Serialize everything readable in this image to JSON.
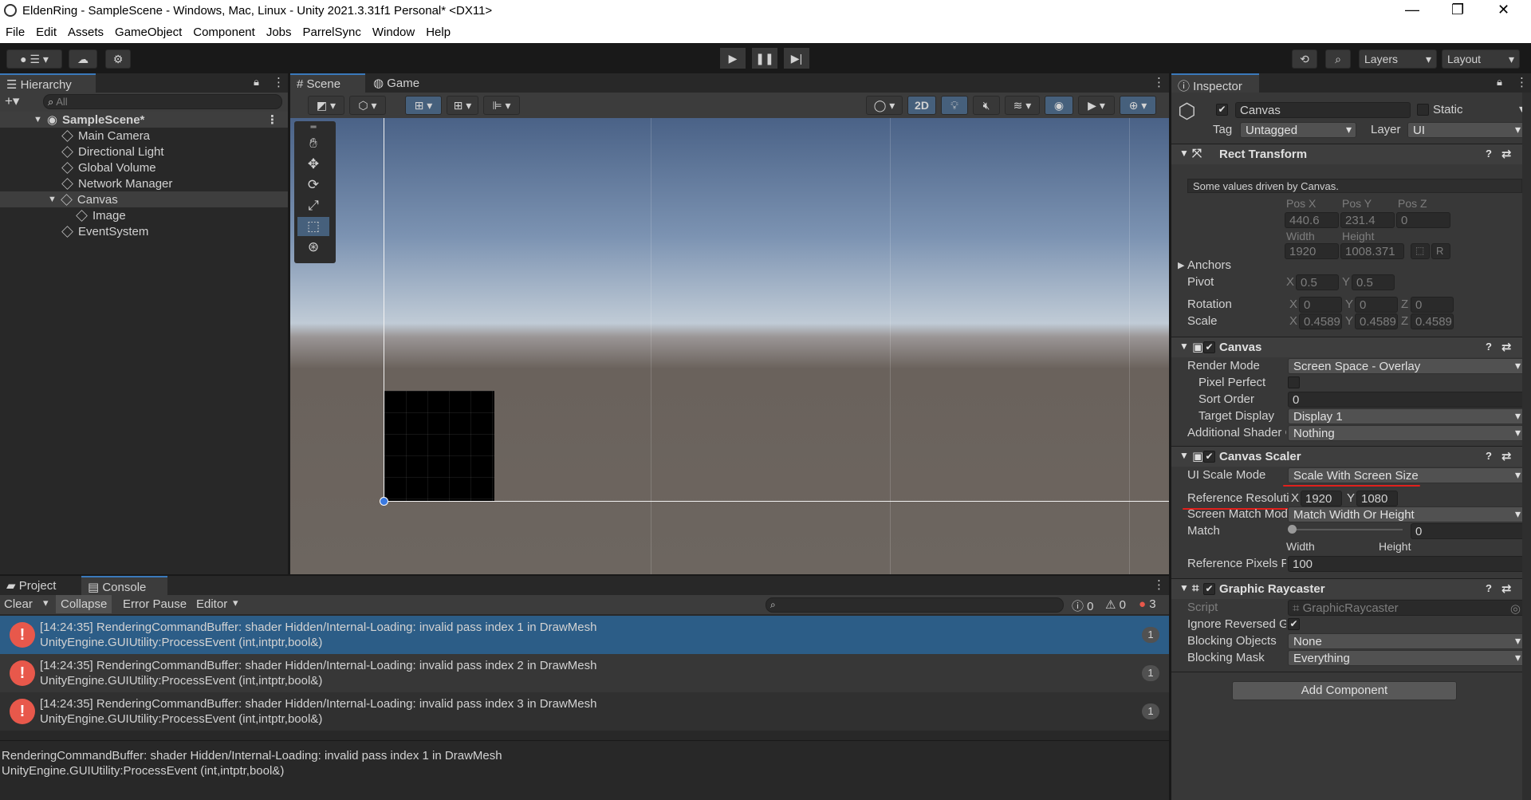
{
  "window": {
    "title": "EldenRing - SampleScene - Windows, Mac, Linux - Unity 2021.3.31f1 Personal* <DX11>",
    "minimize": "—",
    "maximize": "❐",
    "close": "✕"
  },
  "menu": [
    "File",
    "Edit",
    "Assets",
    "GameObject",
    "Component",
    "Jobs",
    "ParrelSync",
    "Window",
    "Help"
  ],
  "toolbar": {
    "layers": "Layers",
    "layout": "Layout"
  },
  "hierarchy": {
    "title": "Hierarchy",
    "search_placeholder": "All",
    "scene": "SampleScene*",
    "items": [
      {
        "label": "Main Camera"
      },
      {
        "label": "Directional Light"
      },
      {
        "label": "Global Volume"
      },
      {
        "label": "Network Manager"
      },
      {
        "label": "Canvas"
      },
      {
        "label": "Image"
      },
      {
        "label": "EventSystem"
      }
    ]
  },
  "scene": {
    "tabs": [
      "Scene",
      "Game"
    ],
    "mode_2d": "2D"
  },
  "inspector": {
    "title": "Inspector",
    "object_name": "Canvas",
    "static_label": "Static",
    "tag_label": "Tag",
    "tag_value": "Untagged",
    "layer_label": "Layer",
    "layer_value": "UI",
    "rect": {
      "title": "Rect Transform",
      "note": "Some values driven by Canvas.",
      "posx_label": "Pos X",
      "posy_label": "Pos Y",
      "posz_label": "Pos Z",
      "posx": "440.6",
      "posy": "231.4",
      "posz": "0",
      "width_label": "Width",
      "height_label": "Height",
      "width": "1920",
      "height": "1008.371",
      "anchors": "Anchors",
      "pivot": "Pivot",
      "pivot_x": "0.5",
      "pivot_y": "0.5",
      "rotation": "Rotation",
      "rot_x": "0",
      "rot_y": "0",
      "rot_z": "0",
      "scale": "Scale",
      "scale_x": "0.4589",
      "scale_y": "0.4589",
      "scale_z": "0.4589",
      "x": "X",
      "y": "Y",
      "z": "Z",
      "r": "R"
    },
    "canvas": {
      "title": "Canvas",
      "render_mode_label": "Render Mode",
      "render_mode": "Screen Space - Overlay",
      "pixel_perfect": "Pixel Perfect",
      "sort_order_label": "Sort Order",
      "sort_order": "0",
      "target_display_label": "Target Display",
      "target_display": "Display 1",
      "shader_label": "Additional Shader Chi",
      "shader_value": "Nothing"
    },
    "scaler": {
      "title": "Canvas Scaler",
      "ui_scale_label": "UI Scale Mode",
      "ui_scale": "Scale With Screen Size",
      "ref_res_label": "Reference Resolution",
      "ref_x": "1920",
      "ref_y": "1080",
      "match_mode_label": "Screen Match Mode",
      "match_mode": "Match Width Or Height",
      "match_label": "Match",
      "match_value": "0",
      "match_fraction": 0,
      "width": "Width",
      "height": "Height",
      "ref_ppu_label": "Reference Pixels Per",
      "ref_ppu": "100"
    },
    "raycaster": {
      "title": "Graphic Raycaster",
      "script_label": "Script",
      "script_value": "GraphicRaycaster",
      "ignore_label": "Ignore Reversed Grap",
      "blocking_objects_label": "Blocking Objects",
      "blocking_objects": "None",
      "blocking_mask_label": "Blocking Mask",
      "blocking_mask": "Everything"
    },
    "add_component": "Add Component"
  },
  "console": {
    "tabs": [
      "Project",
      "Console"
    ],
    "clear": "Clear",
    "collapse": "Collapse",
    "error_pause": "Error Pause",
    "editor": "Editor",
    "count_info": "0",
    "count_warn": "0",
    "count_err": "3",
    "logs": [
      {
        "line1": "[14:24:35] RenderingCommandBuffer: shader Hidden/Internal-Loading: invalid pass index 1 in DrawMesh",
        "line2": "UnityEngine.GUIUtility:ProcessEvent (int,intptr,bool&)",
        "count": "1"
      },
      {
        "line1": "[14:24:35] RenderingCommandBuffer: shader Hidden/Internal-Loading: invalid pass index 2 in DrawMesh",
        "line2": "UnityEngine.GUIUtility:ProcessEvent (int,intptr,bool&)",
        "count": "1"
      },
      {
        "line1": "[14:24:35] RenderingCommandBuffer: shader Hidden/Internal-Loading: invalid pass index 3 in DrawMesh",
        "line2": "UnityEngine.GUIUtility:ProcessEvent (int,intptr,bool&)",
        "count": "1"
      }
    ],
    "detail1": "RenderingCommandBuffer: shader Hidden/Internal-Loading: invalid pass index 1 in DrawMesh",
    "detail2": "UnityEngine.GUIUtility:ProcessEvent (int,intptr,bool&)"
  },
  "colors": {
    "accent": "#3a79bb",
    "selected_row": "#2c5d87",
    "error": "#e8584b",
    "annotation": "#e0201c"
  }
}
